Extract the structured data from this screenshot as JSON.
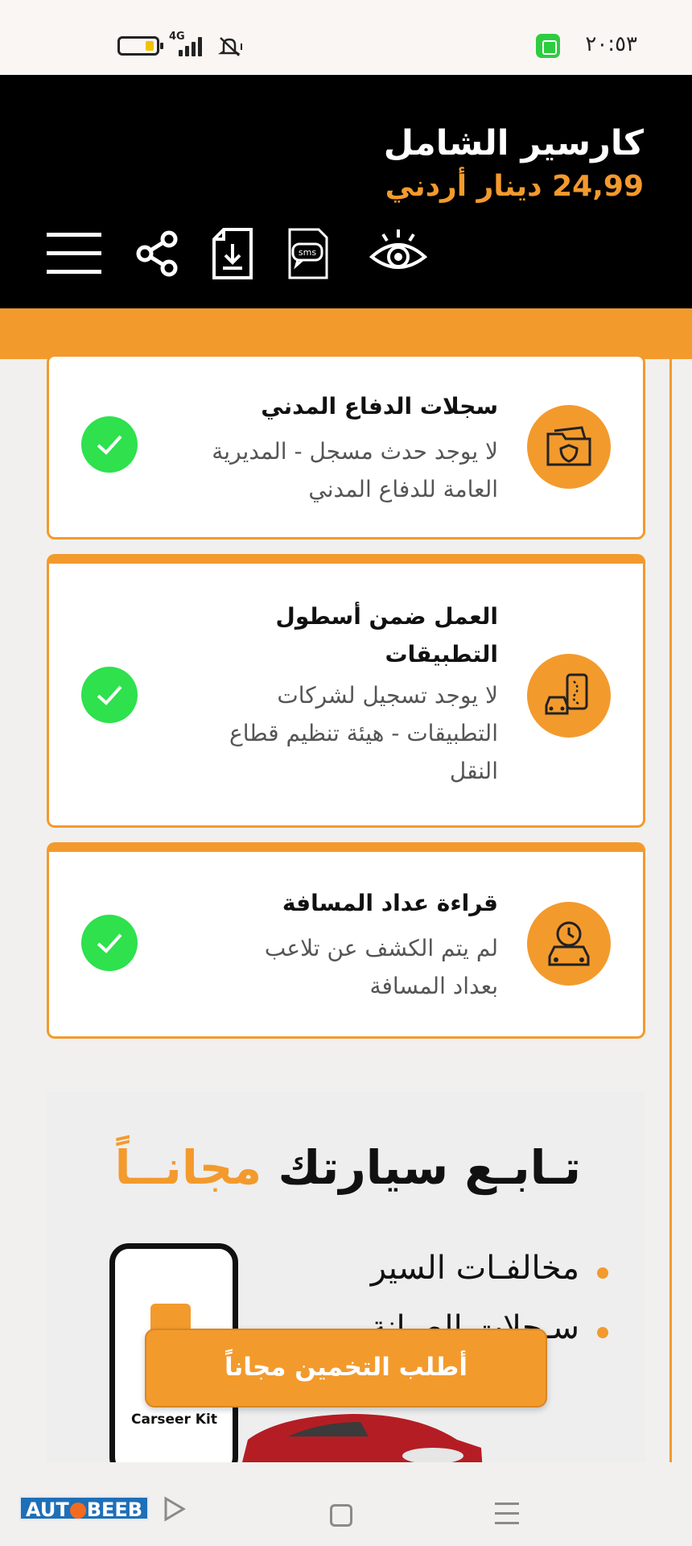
{
  "status_bar": {
    "time": "٢٠:٥٣",
    "network": "4G"
  },
  "header": {
    "title": "كارسير الشامل",
    "price": "24,99 دينار أردني",
    "icons": [
      "menu-icon",
      "share-icon",
      "download-document-icon",
      "sms-icon",
      "eye-icon"
    ]
  },
  "cards": [
    {
      "title": "سجلات الدفاع المدني",
      "desc_lines": [
        "لا يوجد حدث مسجل - المديرية",
        "العامة للدفاع المدني"
      ],
      "icon": "folder-shield-icon",
      "status": "check-icon"
    },
    {
      "title_lines": [
        "العمل ضمن أسطول",
        "التطبيقات"
      ],
      "desc_lines": [
        "لا يوجد تسجيل لشركات",
        "التطبيقات - هيئة تنظيم قطاع",
        "النقل"
      ],
      "icon": "car-phone-route-icon",
      "status": "check-icon"
    },
    {
      "title": "قراءة عداد المسافة",
      "desc_lines": [
        "لم يتم الكشف عن تلاعب",
        "بعداد المسافة"
      ],
      "icon": "car-clock-icon",
      "status": "check-icon"
    }
  ],
  "promo": {
    "headline_main": "تـابـع سيارتك",
    "headline_free": "مجانــاً",
    "bullets": [
      "مخالفـات السير",
      "سـجلات الصيانة"
    ],
    "phone_label": "Carseer Kit"
  },
  "cta": {
    "label": "أطلب التخمين مجاناً"
  },
  "nav": {
    "brand_a": "AUT",
    "brand_b": "BEEB"
  },
  "colors": {
    "accent": "#f39a2d",
    "success": "#2ee14d",
    "header_bg": "#000000"
  }
}
